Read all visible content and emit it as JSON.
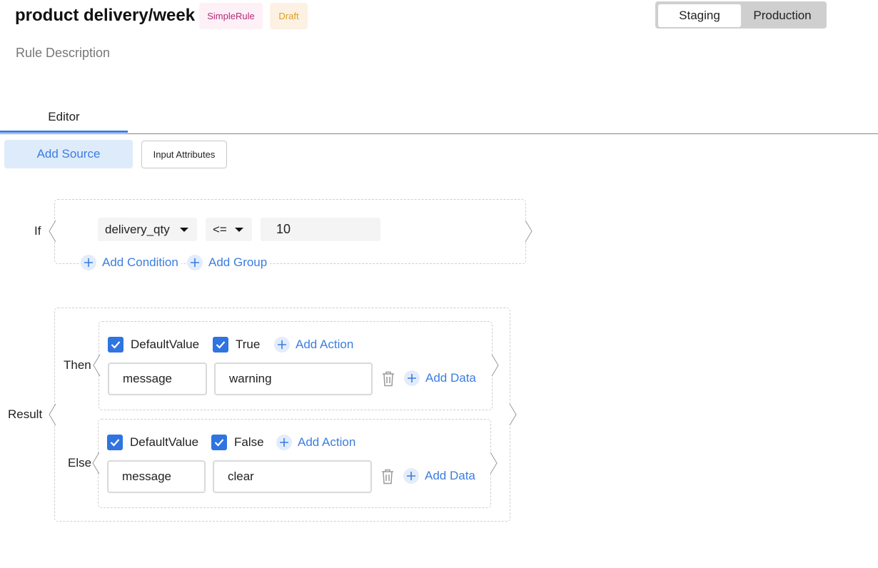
{
  "header": {
    "title": "product delivery/week",
    "badges": {
      "type": "SimpleRule",
      "status": "Draft"
    },
    "description": "Rule Description",
    "environments": [
      "Staging",
      "Production"
    ],
    "active_environment": "Staging"
  },
  "tabs": [
    {
      "label": "Editor",
      "active": true
    }
  ],
  "toolbar": {
    "add_source": "Add Source",
    "input_attributes": "Input Attributes"
  },
  "condition": {
    "label": "If",
    "field": "delivery_qty",
    "operator": "<=",
    "value": "10",
    "add_condition": "Add Condition",
    "add_group": "Add Group"
  },
  "result": {
    "label": "Result",
    "then": {
      "label": "Then",
      "checkbox_default": {
        "label": "DefaultValue",
        "checked": true
      },
      "checkbox_value": {
        "label": "True",
        "checked": true
      },
      "add_action": "Add Action",
      "key": "message",
      "value": "warning",
      "add_data": "Add Data"
    },
    "else": {
      "label": "Else",
      "checkbox_default": {
        "label": "DefaultValue",
        "checked": true
      },
      "checkbox_value": {
        "label": "False",
        "checked": true
      },
      "add_action": "Add Action",
      "key": "message",
      "value": "clear",
      "add_data": "Add Data"
    }
  },
  "colors": {
    "accent": "#3b7de0",
    "checkbox": "#2f74e0",
    "badge_simple_text": "#b22a78",
    "badge_draft_text": "#d9a11e"
  },
  "icons": [
    "plus-icon",
    "check-icon",
    "trash-icon",
    "caret-down-icon",
    "chevron-left-icon",
    "chevron-right-icon"
  ]
}
